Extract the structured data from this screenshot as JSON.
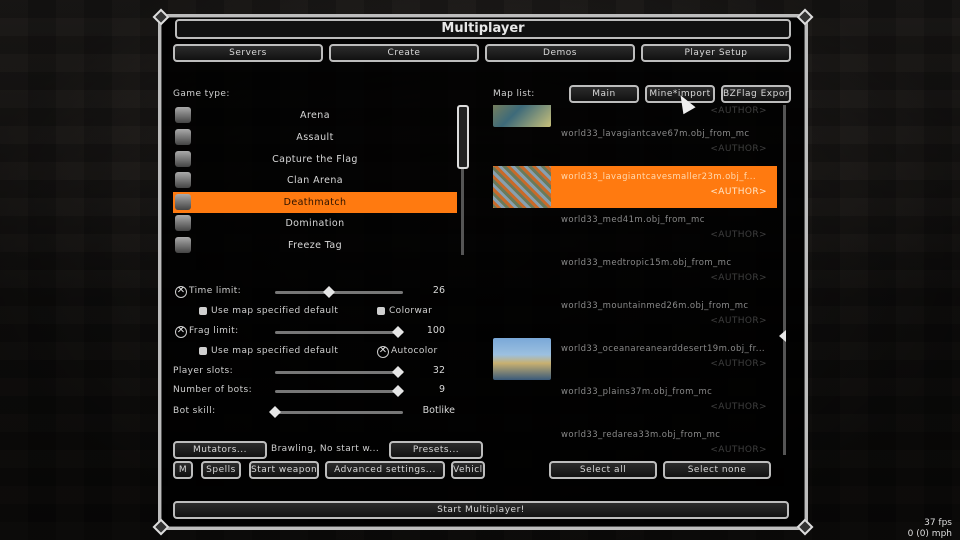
{
  "window": {
    "title": "Multiplayer"
  },
  "top_tabs": [
    "Servers",
    "Create",
    "Demos",
    "Player Setup"
  ],
  "game_type": {
    "label": "Game type:",
    "items": [
      {
        "label": "Arena",
        "icon": "arena-icon"
      },
      {
        "label": "Assault",
        "icon": "assault-icon"
      },
      {
        "label": "Capture the Flag",
        "icon": "ctf-icon"
      },
      {
        "label": "Clan Arena",
        "icon": "clan-arena-icon"
      },
      {
        "label": "Deathmatch",
        "icon": "deathmatch-icon",
        "selected": true
      },
      {
        "label": "Domination",
        "icon": "domination-icon"
      },
      {
        "label": "Freeze Tag",
        "icon": "freeze-tag-icon"
      }
    ]
  },
  "settings": {
    "time_limit": {
      "label": "Time limit:",
      "value": "26",
      "fraction": 0.42
    },
    "use_map_default_1": "Use map specified default",
    "colorwar": "Colorwar",
    "frag_limit": {
      "label": "Frag limit:",
      "value": "100",
      "fraction": 0.96
    },
    "use_map_default_2": "Use map specified default",
    "autocolor": "Autocolor",
    "player_slots": {
      "label": "Player slots:",
      "value": "32",
      "fraction": 0.96
    },
    "num_bots": {
      "label": "Number of bots:",
      "value": "9",
      "fraction": 0.96
    },
    "bot_skill": {
      "label": "Bot skill:",
      "value": "Botlike",
      "fraction": 0.0
    }
  },
  "bottom_left": {
    "mutators": "Mutators...",
    "mutators_summary": "Brawling, No start w...",
    "presets": "Presets...",
    "m": "M",
    "spells": "Spells",
    "start_weapons": "Start weapons",
    "advanced": "Advanced settings...",
    "vehicles": "Vehicles"
  },
  "map_list": {
    "label": "Map list:",
    "buttons": [
      "Main",
      "Mine*import",
      "BZFlag Export"
    ],
    "items": [
      {
        "name": "",
        "author": "<AUTHOR>",
        "thumb": "partial"
      },
      {
        "name": "world33_lavagiantcave67m.obj_from_mc",
        "author": "<AUTHOR>",
        "thumb": "none"
      },
      {
        "name": "world33_lavagiantcavesmaller23m.obj_f...",
        "author": "<AUTHOR>",
        "thumb": "lava",
        "selected": true
      },
      {
        "name": "world33_med41m.obj_from_mc",
        "author": "<AUTHOR>",
        "thumb": "none"
      },
      {
        "name": "world33_medtropic15m.obj_from_mc",
        "author": "<AUTHOR>",
        "thumb": "none"
      },
      {
        "name": "world33_mountainmed26m.obj_from_mc",
        "author": "<AUTHOR>",
        "thumb": "none"
      },
      {
        "name": "world33_oceanareanearddesert19m.obj_fr...",
        "author": "<AUTHOR>",
        "thumb": "sky"
      },
      {
        "name": "world33_plains37m.obj_from_mc",
        "author": "<AUTHOR>",
        "thumb": "none"
      },
      {
        "name": "world33_redarea33m.obj_from_mc",
        "author": "<AUTHOR>",
        "thumb": "none"
      }
    ],
    "select_all": "Select all",
    "select_none": "Select none"
  },
  "start_button": "Start Multiplayer!",
  "hud": {
    "fps": "37 fps",
    "mph": "0 (0) mph"
  },
  "colors": {
    "accent": "#ff7a10",
    "frame": "#bdbdbd"
  }
}
